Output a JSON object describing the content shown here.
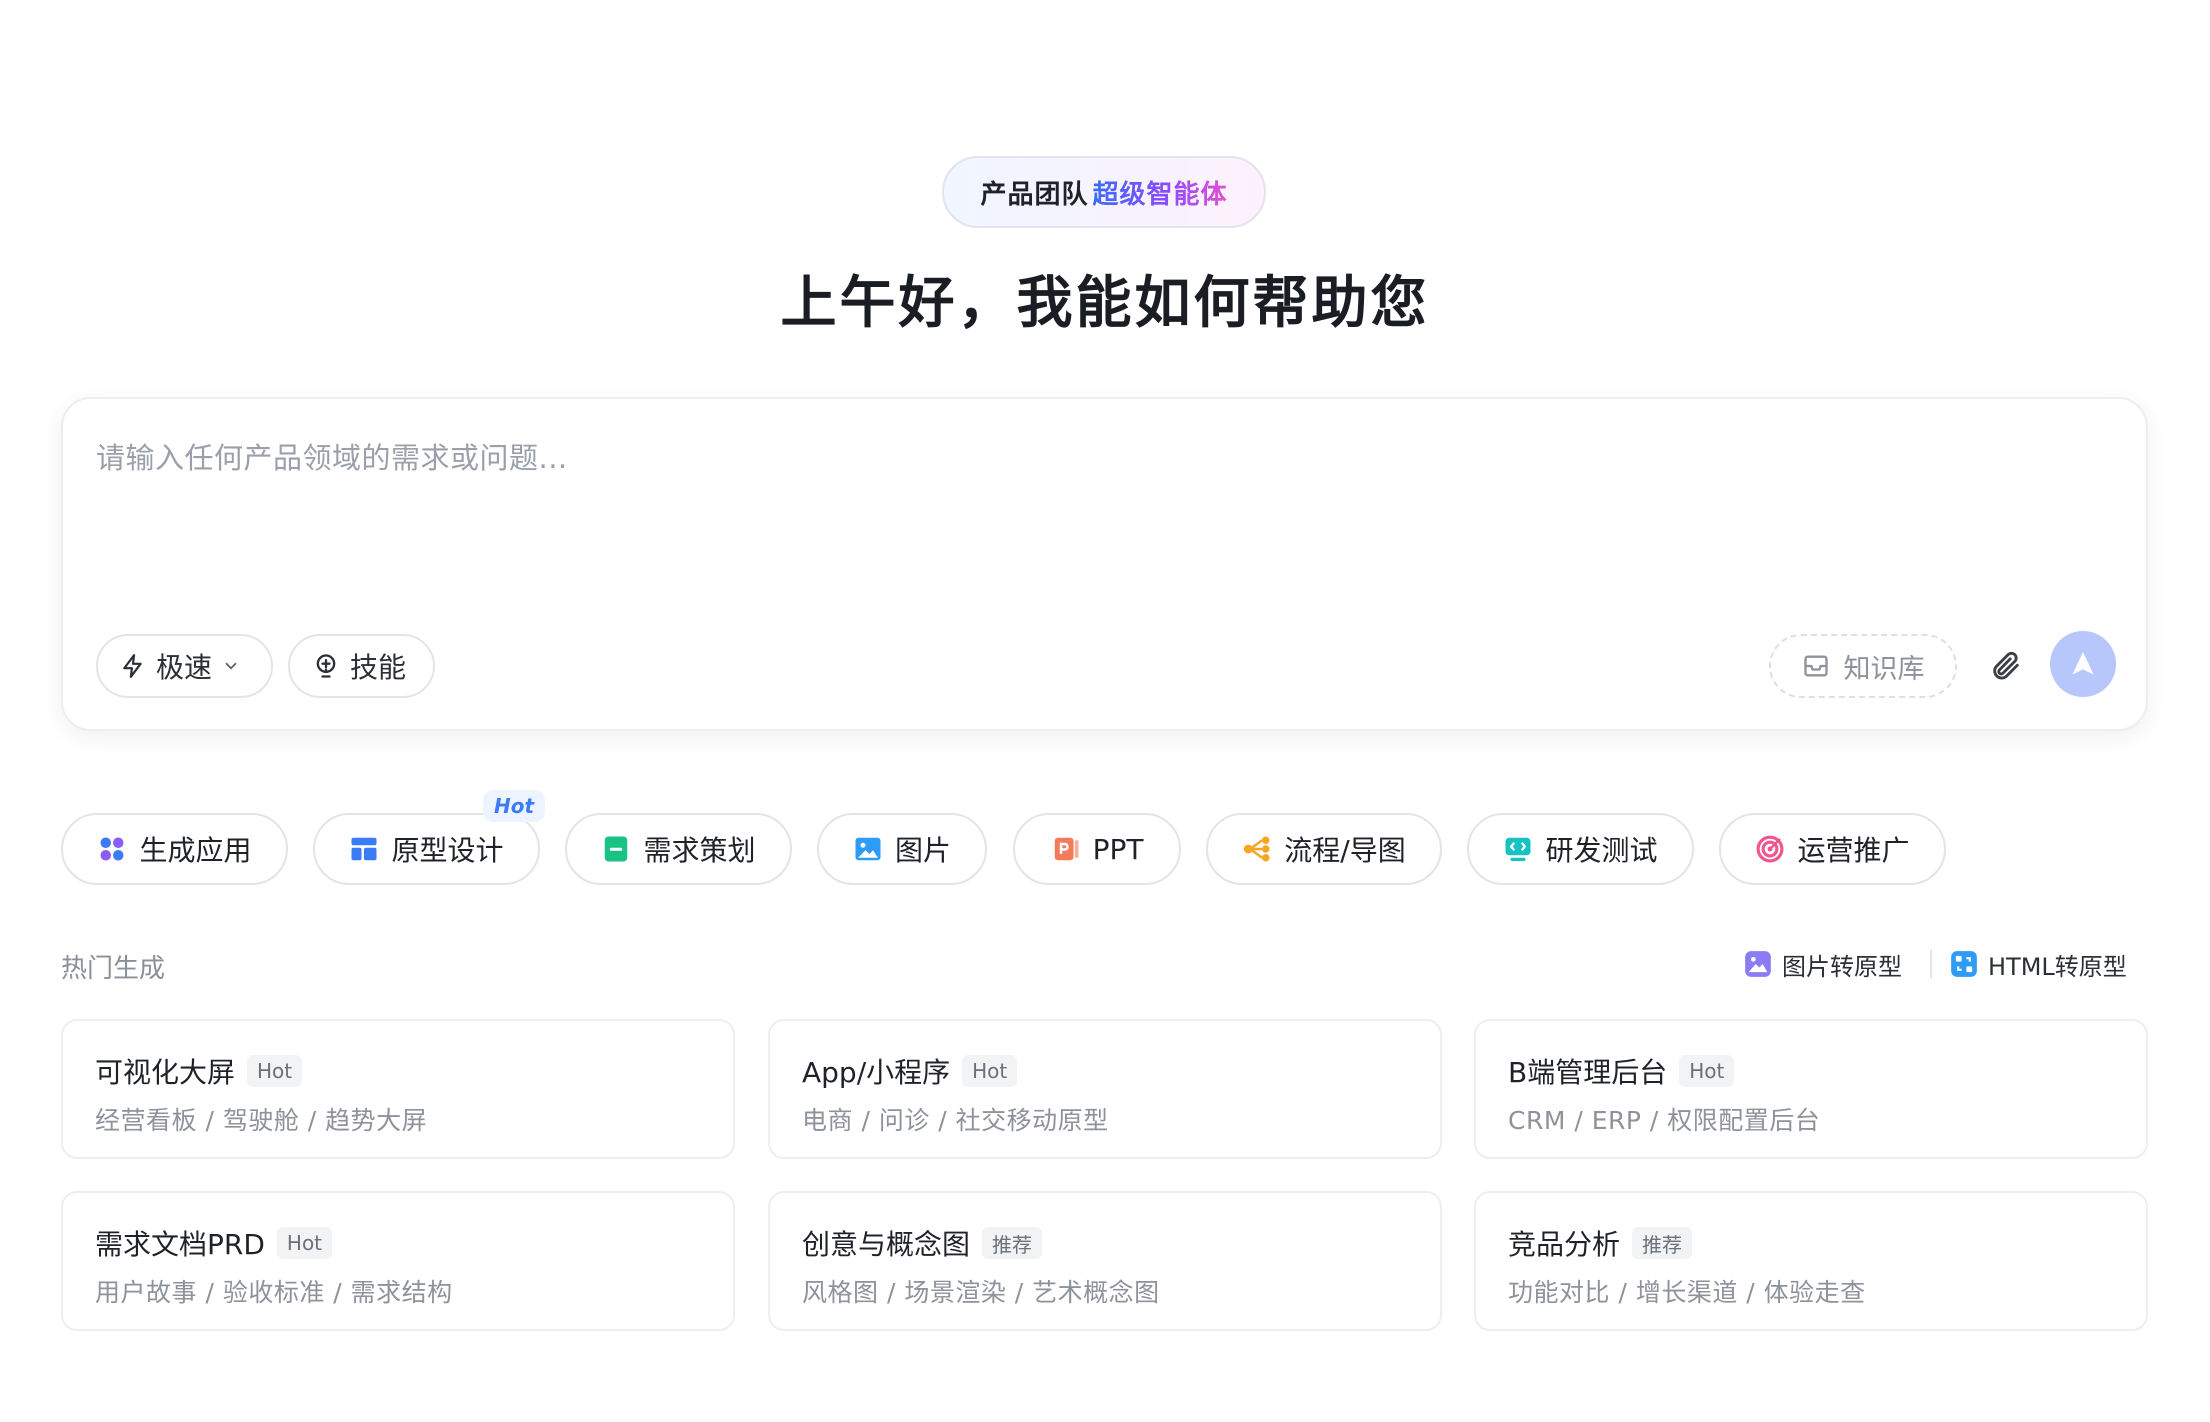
{
  "hero": {
    "badge_plain": "产品团队",
    "badge_gradient": "超级智能体",
    "greeting": "上午好，我能如何帮助您"
  },
  "prompt": {
    "placeholder": "请输入任何产品领域的需求或问题...",
    "speed_label": "极速",
    "skill_label": "技能",
    "knowledge_label": "知识库",
    "attach_icon": "paperclip-icon",
    "send_icon": "send-arrow-icon",
    "send_color": "#b8c7fb"
  },
  "categories": [
    {
      "label": "生成应用",
      "icon": "apps-grid-icon",
      "color": "#6b5cf6"
    },
    {
      "label": "原型设计",
      "icon": "layout-icon",
      "color": "#3b7cf6",
      "tag": "Hot"
    },
    {
      "label": "需求策划",
      "icon": "document-icon",
      "color": "#17c283"
    },
    {
      "label": "图片",
      "icon": "image-icon",
      "color": "#2e9bf4"
    },
    {
      "label": "PPT",
      "icon": "ppt-icon",
      "color": "#f47a5b"
    },
    {
      "label": "流程/导图",
      "icon": "mindmap-icon",
      "color": "#f5a623"
    },
    {
      "label": "研发测试",
      "icon": "code-icon",
      "color": "#16c2c2"
    },
    {
      "label": "运营推广",
      "icon": "target-icon",
      "color": "#f0568e"
    }
  ],
  "section": {
    "title": "热门生成",
    "image_to_prototype": "图片转原型",
    "html_to_prototype": "HTML转原型"
  },
  "cards": [
    {
      "title": "可视化大屏",
      "tag": "Hot",
      "subtitle": "经营看板 / 驾驶舱 / 趋势大屏"
    },
    {
      "title": "App/小程序",
      "tag": "Hot",
      "subtitle": "电商 / 问诊 / 社交移动原型"
    },
    {
      "title": "B端管理后台",
      "tag": "Hot",
      "subtitle": "CRM / ERP / 权限配置后台"
    },
    {
      "title": "需求文档PRD",
      "tag": "Hot",
      "subtitle": "用户故事 / 验收标准 / 需求结构"
    },
    {
      "title": "创意与概念图",
      "tag": "推荐",
      "subtitle": "风格图 / 场景渲染 / 艺术概念图"
    },
    {
      "title": "竞品分析",
      "tag": "推荐",
      "subtitle": "功能对比 / 增长渠道 / 体验走查"
    }
  ]
}
